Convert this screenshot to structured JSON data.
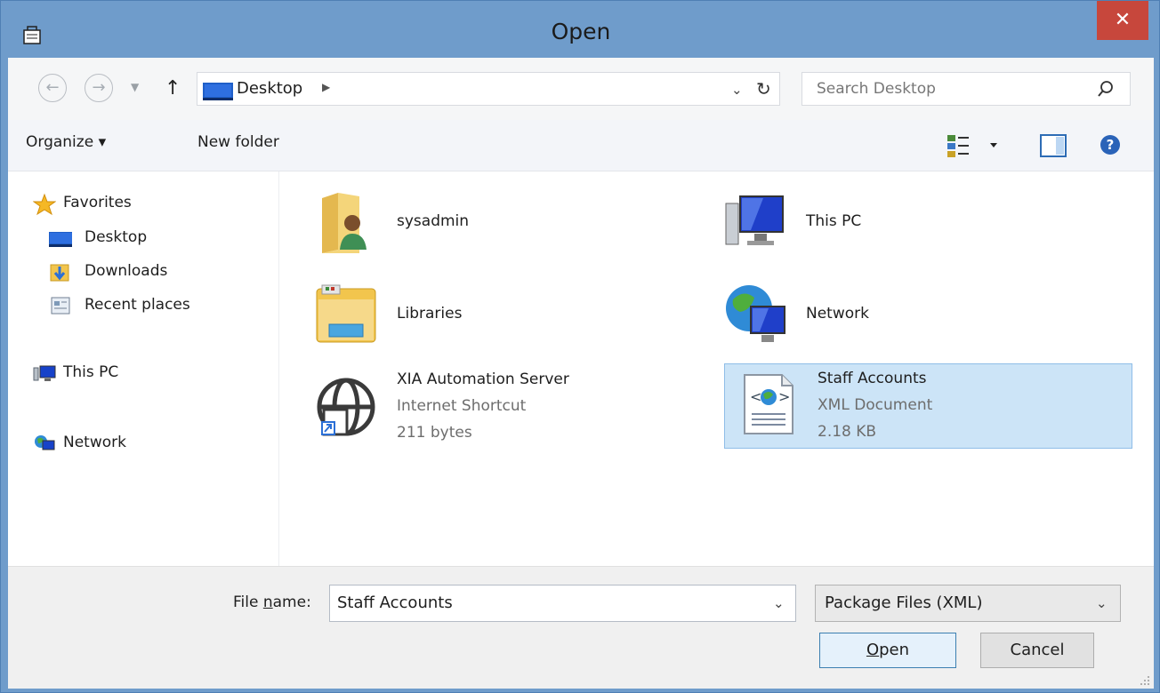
{
  "window": {
    "title": "Open",
    "close_glyph": "✕"
  },
  "nav": {
    "back_glyph": "←",
    "forward_glyph": "→",
    "up_glyph": "↑",
    "address": "Desktop",
    "search_placeholder": "Search Desktop"
  },
  "toolbar": {
    "organize": "Organize ▾",
    "new_folder": "New folder"
  },
  "sidebar": {
    "items": [
      {
        "label": "Favorites",
        "icon": "star-icon"
      },
      {
        "label": "Desktop",
        "icon": "desktop-icon"
      },
      {
        "label": "Downloads",
        "icon": "downloads-icon"
      },
      {
        "label": "Recent places",
        "icon": "recent-places-icon"
      },
      {
        "label": "This PC",
        "icon": "computer-icon"
      },
      {
        "label": "Network",
        "icon": "network-icon"
      }
    ]
  },
  "files": [
    {
      "name": "sysadmin",
      "type": "",
      "size": "",
      "icon": "user-folder-icon"
    },
    {
      "name": "This PC",
      "type": "",
      "size": "",
      "icon": "computer-icon"
    },
    {
      "name": "Libraries",
      "type": "",
      "size": "",
      "icon": "libraries-icon"
    },
    {
      "name": "Network",
      "type": "",
      "size": "",
      "icon": "network-globe-icon"
    },
    {
      "name": "XIA Automation Server",
      "type": "Internet Shortcut",
      "size": "211 bytes",
      "icon": "web-shortcut-icon"
    },
    {
      "name": "Staff Accounts",
      "type": "XML Document",
      "size": "2.18 KB",
      "icon": "xml-document-icon",
      "selected": true
    }
  ],
  "footer": {
    "file_name_label_prefix": "File ",
    "file_name_label_underlined": "n",
    "file_name_label_suffix": "ame:",
    "file_name_value": "Staff Accounts",
    "file_type_value": "Package Files (XML)",
    "open_underlined": "O",
    "open_rest": "pen",
    "cancel": "Cancel"
  },
  "colors": {
    "title_bar": "#6f9ccb",
    "close_button": "#c7473c",
    "selection": "#cce4f7",
    "selection_border": "#8fbde8"
  }
}
